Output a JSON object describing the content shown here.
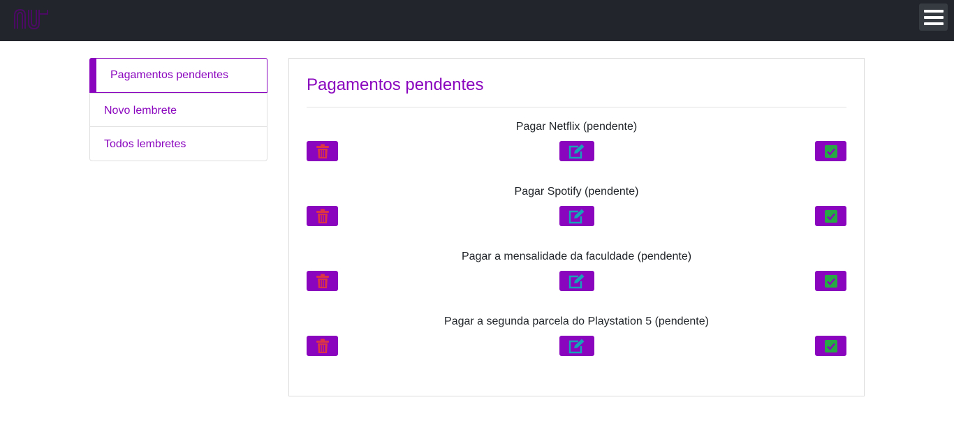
{
  "navbar": {
    "logo_icon": "nubank-logo",
    "menu_icon": "hamburger-icon",
    "accent": "#8a05be"
  },
  "sidebar": {
    "items": [
      {
        "label": "Pagamentos pendentes",
        "active": true
      },
      {
        "label": "Novo lembrete",
        "active": false
      },
      {
        "label": "Todos lembretes",
        "active": false
      }
    ]
  },
  "main": {
    "title": "Pagamentos pendentes",
    "reminders": [
      {
        "text": "Pagar Netflix (pendente)"
      },
      {
        "text": "Pagar Spotify (pendente)"
      },
      {
        "text": "Pagar a mensalidade da faculdade (pendente)"
      },
      {
        "text": "Pagar a segunda parcela do Playstation 5 (pendente)"
      }
    ],
    "actions": {
      "delete_icon": "trash-icon",
      "edit_icon": "edit-icon",
      "done_icon": "check-square-icon",
      "delete_color": "#dc3545",
      "edit_color": "#17a2b8",
      "done_color": "#28a745"
    }
  }
}
